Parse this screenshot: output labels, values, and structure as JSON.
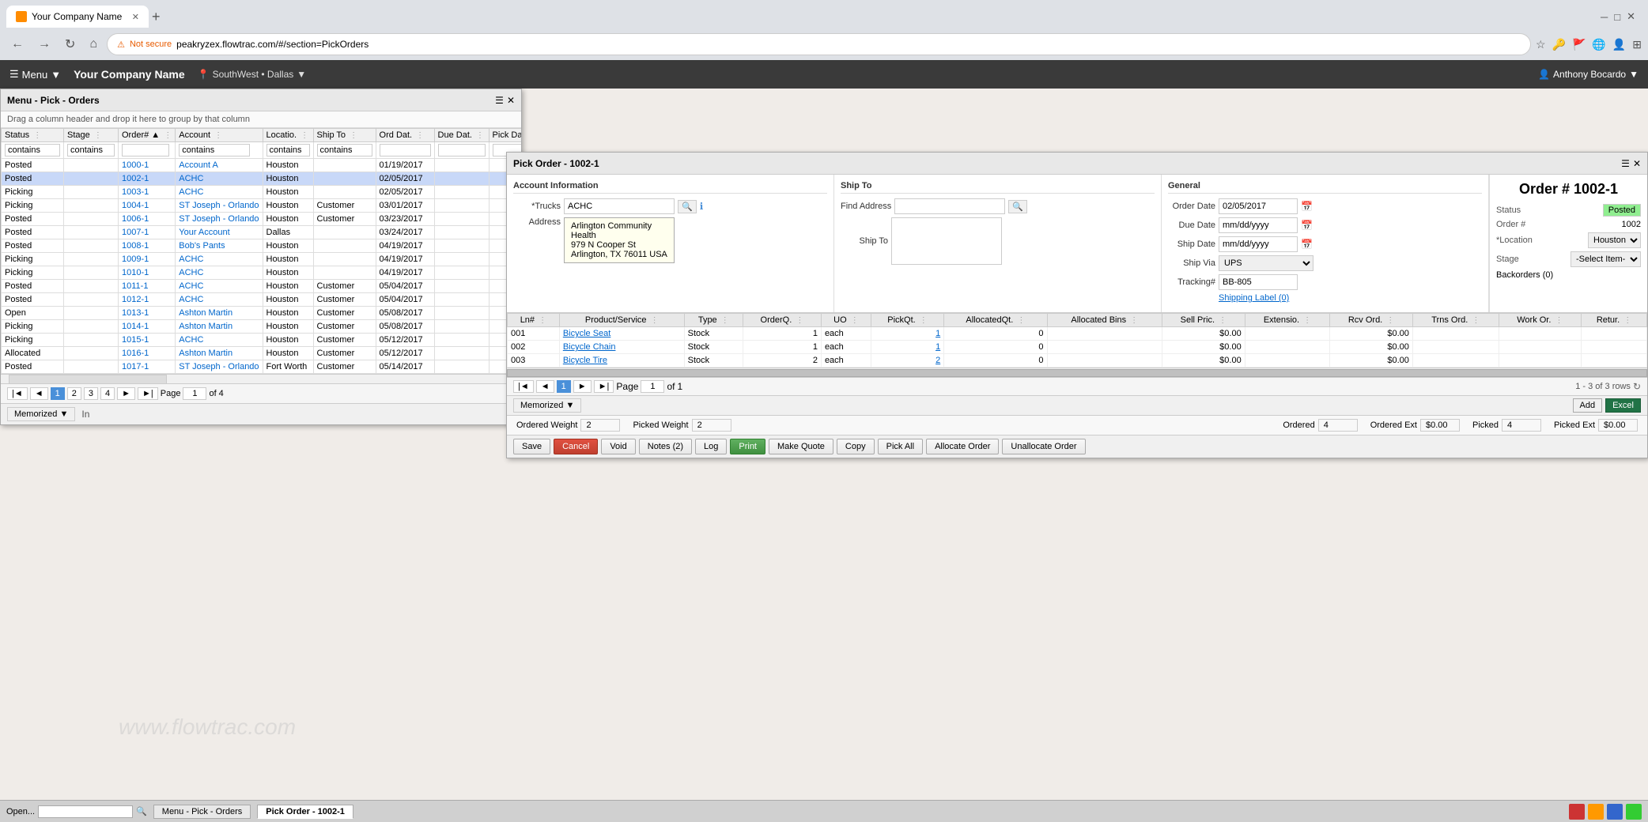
{
  "browser": {
    "tab_title": "Your Company Name",
    "favicon_color": "#ff8c00",
    "url": "peakryzex.flowtrac.com/#/section=PickOrders",
    "warning_text": "Not secure",
    "new_tab_symbol": "+"
  },
  "app_bar": {
    "menu_label": "Menu",
    "company_name": "Your Company Name",
    "location_pin": "📍",
    "location": "SouthWest • Dallas",
    "user_icon": "👤",
    "user_name": "Anthony Bocardo"
  },
  "pick_orders_panel": {
    "title": "Menu - Pick - Orders",
    "drag_hint": "Drag a column header and drop it here to group by that column",
    "columns": [
      "Status",
      "Stage",
      "Order#",
      "Account",
      "Location",
      "Ship To",
      "Ord Dat.",
      "Due Dat.",
      "Pick Dat."
    ],
    "filter_placeholders": [
      "contains",
      "contains",
      "",
      "contains",
      "contains",
      "contains",
      "",
      "",
      ""
    ],
    "rows": [
      {
        "status": "Posted",
        "stage": "",
        "order": "1000-1",
        "account": "Account A",
        "location": "Houston",
        "ship_to": "",
        "ord_date": "01/19/2017",
        "due_date": "",
        "pick_date": ""
      },
      {
        "status": "Posted",
        "stage": "",
        "order": "1002-1",
        "account": "ACHC",
        "location": "Houston",
        "ship_to": "",
        "ord_date": "02/05/2017",
        "due_date": "",
        "pick_date": ""
      },
      {
        "status": "Picking",
        "stage": "",
        "order": "1003-1",
        "account": "ACHC",
        "location": "Houston",
        "ship_to": "",
        "ord_date": "02/05/2017",
        "due_date": "",
        "pick_date": ""
      },
      {
        "status": "Picking",
        "stage": "",
        "order": "1004-1",
        "account": "ST Joseph - Orlando",
        "location": "Houston",
        "ship_to": "Customer",
        "ord_date": "03/01/2017",
        "due_date": "",
        "pick_date": ""
      },
      {
        "status": "Posted",
        "stage": "",
        "order": "1006-1",
        "account": "ST Joseph - Orlando",
        "location": "Houston",
        "ship_to": "Customer",
        "ord_date": "03/23/2017",
        "due_date": "",
        "pick_date": ""
      },
      {
        "status": "Posted",
        "stage": "",
        "order": "1007-1",
        "account": "Your Account",
        "location": "Dallas",
        "ship_to": "",
        "ord_date": "03/24/2017",
        "due_date": "",
        "pick_date": ""
      },
      {
        "status": "Posted",
        "stage": "",
        "order": "1008-1",
        "account": "Bob's Pants",
        "location": "Houston",
        "ship_to": "",
        "ord_date": "04/19/2017",
        "due_date": "",
        "pick_date": ""
      },
      {
        "status": "Picking",
        "stage": "",
        "order": "1009-1",
        "account": "ACHC",
        "location": "Houston",
        "ship_to": "",
        "ord_date": "04/19/2017",
        "due_date": "",
        "pick_date": ""
      },
      {
        "status": "Picking",
        "stage": "",
        "order": "1010-1",
        "account": "ACHC",
        "location": "Houston",
        "ship_to": "",
        "ord_date": "04/19/2017",
        "due_date": "",
        "pick_date": ""
      },
      {
        "status": "Posted",
        "stage": "",
        "order": "1011-1",
        "account": "ACHC",
        "location": "Houston",
        "ship_to": "Customer",
        "ord_date": "05/04/2017",
        "due_date": "",
        "pick_date": ""
      },
      {
        "status": "Posted",
        "stage": "",
        "order": "1012-1",
        "account": "ACHC",
        "location": "Houston",
        "ship_to": "Customer",
        "ord_date": "05/04/2017",
        "due_date": "",
        "pick_date": ""
      },
      {
        "status": "Open",
        "stage": "",
        "order": "1013-1",
        "account": "Ashton Martin",
        "location": "Houston",
        "ship_to": "Customer",
        "ord_date": "05/08/2017",
        "due_date": "",
        "pick_date": ""
      },
      {
        "status": "Picking",
        "stage": "",
        "order": "1014-1",
        "account": "Ashton Martin",
        "location": "Houston",
        "ship_to": "Customer",
        "ord_date": "05/08/2017",
        "due_date": "",
        "pick_date": ""
      },
      {
        "status": "Picking",
        "stage": "",
        "order": "1015-1",
        "account": "ACHC",
        "location": "Houston",
        "ship_to": "Customer",
        "ord_date": "05/12/2017",
        "due_date": "",
        "pick_date": ""
      },
      {
        "status": "Allocated",
        "stage": "",
        "order": "1016-1",
        "account": "Ashton Martin",
        "location": "Houston",
        "ship_to": "Customer",
        "ord_date": "05/12/2017",
        "due_date": "",
        "pick_date": ""
      },
      {
        "status": "Posted",
        "stage": "",
        "order": "1017-1",
        "account": "ST Joseph - Orlando",
        "location": "Fort Worth",
        "ship_to": "Customer",
        "ord_date": "05/14/2017",
        "due_date": "",
        "pick_date": ""
      }
    ],
    "pagination": {
      "pages": [
        "1",
        "2",
        "3",
        "4"
      ],
      "current_page": "1",
      "total_pages": "4",
      "page_label": "Page",
      "of_label": "of"
    }
  },
  "pick_order_detail": {
    "title": "Pick Order - 1002-1",
    "account_section": {
      "heading": "Account Information",
      "trucks_label": "*Trucks",
      "trucks_value": "ACHC",
      "address_label": "Address",
      "address_value": "Arlington Community\nHealth\n979 N Cooper St\nArlington, TX 76011 USA"
    },
    "ship_to_section": {
      "heading": "Ship To",
      "find_address_label": "Find Address",
      "ship_to_label": "Ship To"
    },
    "general_section": {
      "heading": "General",
      "order_date_label": "Order Date",
      "order_date": "02/05/2017",
      "due_date_label": "Due Date",
      "due_date": "mm/dd/yyyy",
      "ship_date_label": "Ship Date",
      "ship_date": "mm/dd/yyyy",
      "ship_via_label": "Ship Via",
      "ship_via": "UPS",
      "tracking_label": "Tracking#",
      "tracking_value": "BB-805",
      "shipping_label": "Shipping Label (0)"
    },
    "summary": {
      "order_label": "Order #",
      "order_value": "1002-1",
      "status_label": "Status",
      "status_value": "Posted",
      "order_num_label": "Order #",
      "order_num_value": "1002",
      "location_label": "*Location",
      "location_value": "Houston",
      "stage_label": "Stage",
      "stage_value": "-Select Item-",
      "backorders_label": "Backorders (0)"
    },
    "line_items": {
      "columns": [
        "Ln#",
        "Product/Service",
        "Type",
        "OrderQ.",
        "UO",
        "PickQt.",
        "AllocatedQt.",
        "Allocated Bins",
        "Sell Pric.",
        "Extensio.",
        "Rcv Ord.",
        "Trns Ord.",
        "Work Or.",
        "Retur."
      ],
      "rows": [
        {
          "ln": "001",
          "product": "Bicycle Seat",
          "type": "Stock",
          "order_qty": "1",
          "uo": "each",
          "pick_qty": "1",
          "alloc_qty": "0",
          "alloc_bins": "",
          "sell_price": "$0.00",
          "extension": "",
          "rcv_ord": "$0.00",
          "trns_ord": "",
          "work_ord": "",
          "retur": ""
        },
        {
          "ln": "002",
          "product": "Bicycle Chain",
          "type": "Stock",
          "order_qty": "1",
          "uo": "each",
          "pick_qty": "1",
          "alloc_qty": "0",
          "alloc_bins": "",
          "sell_price": "$0.00",
          "extension": "",
          "rcv_ord": "$0.00",
          "trns_ord": "",
          "work_ord": "",
          "retur": ""
        },
        {
          "ln": "003",
          "product": "Bicycle Tire",
          "type": "Stock",
          "order_qty": "2",
          "uo": "each",
          "pick_qty": "2",
          "alloc_qty": "0",
          "alloc_bins": "",
          "sell_price": "$0.00",
          "extension": "",
          "rcv_ord": "$0.00",
          "trns_ord": "",
          "work_ord": "",
          "retur": ""
        }
      ]
    },
    "pagination": {
      "current": "1",
      "total": "1",
      "rows_info": "1 - 3 of 3 rows"
    },
    "totals": {
      "ordered_weight_label": "Ordered Weight",
      "ordered_weight": "2",
      "picked_weight_label": "Picked Weight",
      "picked_weight": "2",
      "ordered_label": "Ordered",
      "ordered_value": "4",
      "ordered_ext_label": "Ordered Ext",
      "ordered_ext": "$0.00",
      "picked_label": "Picked",
      "picked_value": "4",
      "picked_ext_label": "Picked Ext",
      "picked_ext": "$0.00"
    },
    "buttons": {
      "save": "Save",
      "cancel": "Cancel",
      "void": "Void",
      "notes": "Notes",
      "notes_count": "(2)",
      "log": "Log",
      "print": "Print",
      "make_quote": "Make Quote",
      "copy": "Copy",
      "pick_all": "Pick All",
      "allocate_order": "Allocate Order",
      "unallocate_order": "Unallocate Order"
    }
  },
  "taskbar": {
    "open_label": "Open...",
    "items": [
      "Menu - Pick - Orders",
      "Pick Order - 1002-1"
    ]
  },
  "colors": {
    "red": "#cc3333",
    "orange": "#ff9900",
    "blue": "#3366cc",
    "green": "#33cc33"
  }
}
